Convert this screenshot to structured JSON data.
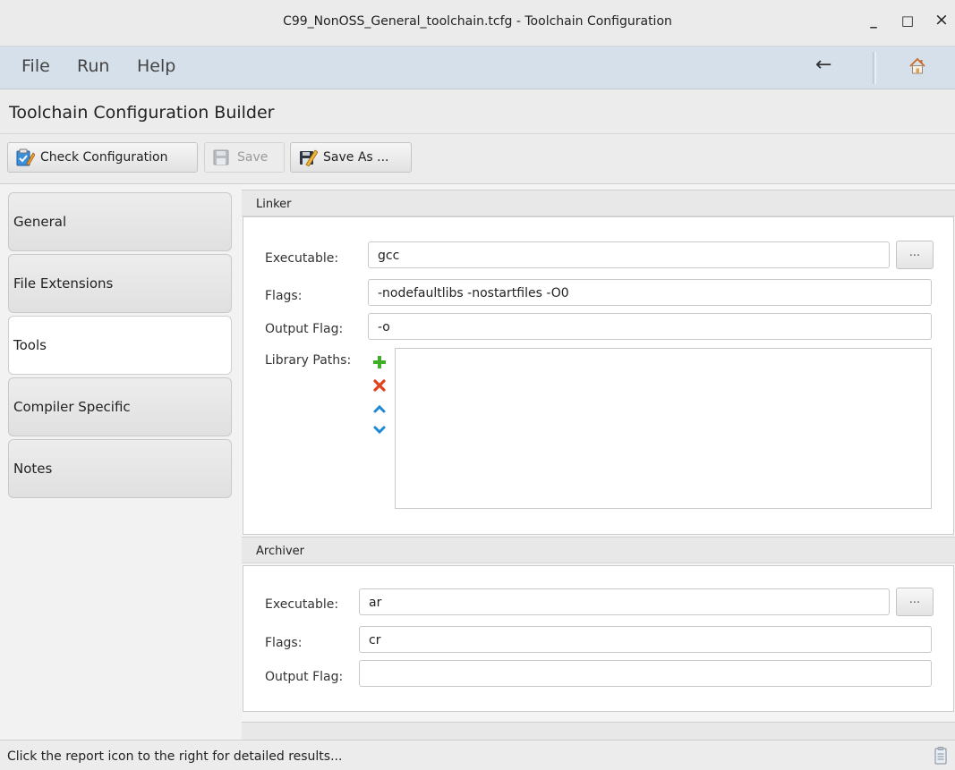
{
  "window": {
    "title": "C99_NonOSS_General_toolchain.tcfg - Toolchain Configuration",
    "minimize": "_",
    "maximize": "□",
    "close": "×"
  },
  "menu": {
    "items": [
      "File",
      "Run",
      "Help"
    ],
    "back": "←"
  },
  "header": {
    "title": "Toolchain Configuration Builder"
  },
  "toolbar": {
    "check": "Check Configuration",
    "save": "Save",
    "save_as": "Save As ..."
  },
  "sidebar": {
    "tabs": [
      "General",
      "File Extensions",
      "Tools",
      "Compiler Specific",
      "Notes"
    ],
    "active": "Tools"
  },
  "linker": {
    "section": "Linker",
    "executable_label": "Executable:",
    "executable": "gcc",
    "browse": "...",
    "flags_label": "Flags:",
    "flags": "-nodefaultlibs -nostartfiles -O0",
    "output_flag_label": "Output Flag:",
    "output_flag": "-o",
    "library_paths_label": "Library Paths:"
  },
  "archiver": {
    "section": "Archiver",
    "executable_label": "Executable:",
    "executable": "ar",
    "browse": "...",
    "flags_label": "Flags:",
    "flags": "cr",
    "output_flag_label": "Output Flag:",
    "output_flag": ""
  },
  "status": {
    "text": "Click the report icon to the right for detailed results..."
  },
  "colors": {
    "menubar": "#d6e0ea",
    "add": "#3fae29",
    "remove": "#e2421b",
    "move": "#1e88d6"
  }
}
